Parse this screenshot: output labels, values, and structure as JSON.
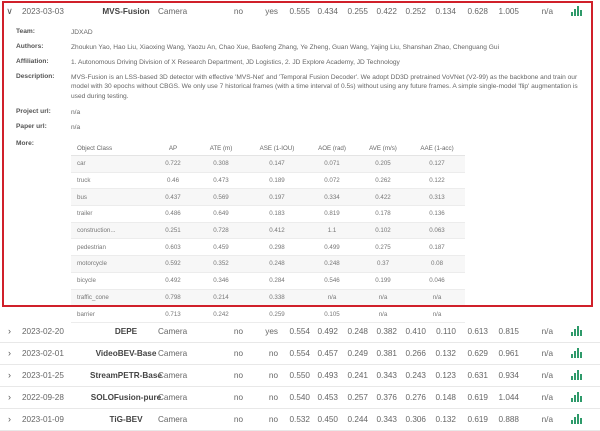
{
  "expanded_entry": {
    "date": "2023-03-03",
    "method": "MVS-Fusion",
    "modality": "Camera",
    "extra_data": "no",
    "tta": "yes",
    "metrics": [
      "0.555",
      "0.434",
      "0.255",
      "0.422",
      "0.252",
      "0.134",
      "0.628",
      "1.005"
    ],
    "last": "n/a",
    "details": {
      "team_label": "Team:",
      "team": "JDXAD",
      "authors_label": "Authors:",
      "authors": "Zhoukun Yao, Hao Liu, Xiaoxing Wang, Yaozu An, Chao Xue, Baofeng Zhang, Ye Zheng, Guan Wang, Yajing Liu, Shanshan Zhao, Chenguang Gui",
      "affiliation_label": "Affiliation:",
      "affiliation": "1. Autonomous Driving Division of X Research Department, JD Logistics, 2. JD Explore Academy, JD Technology",
      "description_label": "Description:",
      "description": "MVS-Fusion is an LSS-based 3D detector with effective 'MVS-Net' and 'Temporal Fusion Decoder'. We adopt DD3D pretrained VoVNet (V2-99) as the backbone and train our model with 30 epochs without CBGS. We only use 7 historical frames (with a time interval of 0.5s) without using any future frames. A simple single-model 'flip' augmentation is used during testing.",
      "project_url_label": "Project url:",
      "project_url": "n/a",
      "paper_url_label": "Paper url:",
      "paper_url": "n/a",
      "more_label": "More:"
    },
    "object_table": {
      "headers": [
        "Object Class",
        "AP",
        "ATE (m)",
        "ASE (1-IOU)",
        "AOE (rad)",
        "AVE (m/s)",
        "AAE (1-acc)"
      ],
      "rows": [
        [
          "car",
          "0.722",
          "0.308",
          "0.147",
          "0.071",
          "0.205",
          "0.127"
        ],
        [
          "truck",
          "0.46",
          "0.473",
          "0.189",
          "0.072",
          "0.262",
          "0.122"
        ],
        [
          "bus",
          "0.437",
          "0.569",
          "0.197",
          "0.334",
          "0.422",
          "0.313"
        ],
        [
          "trailer",
          "0.486",
          "0.649",
          "0.183",
          "0.819",
          "0.178",
          "0.136"
        ],
        [
          "construction...",
          "0.251",
          "0.728",
          "0.412",
          "1.1",
          "0.102",
          "0.063"
        ],
        [
          "pedestrian",
          "0.603",
          "0.459",
          "0.298",
          "0.499",
          "0.275",
          "0.187"
        ],
        [
          "motorcycle",
          "0.592",
          "0.352",
          "0.248",
          "0.248",
          "0.37",
          "0.08"
        ],
        [
          "bicycle",
          "0.492",
          "0.346",
          "0.284",
          "0.546",
          "0.199",
          "0.046"
        ],
        [
          "traffic_cone",
          "0.798",
          "0.214",
          "0.338",
          "n/a",
          "n/a",
          "n/a"
        ],
        [
          "barrier",
          "0.713",
          "0.242",
          "0.259",
          "0.105",
          "n/a",
          "n/a"
        ]
      ]
    }
  },
  "entries": [
    {
      "date": "2023-02-20",
      "method": "DEPE",
      "modality": "Camera",
      "extra_data": "no",
      "tta": "yes",
      "metrics": [
        "0.554",
        "0.492",
        "0.248",
        "0.382",
        "0.410",
        "0.110",
        "0.613",
        "0.815"
      ],
      "last": "n/a"
    },
    {
      "date": "2023-02-01",
      "method": "VideoBEV-Base",
      "modality": "Camera",
      "extra_data": "no",
      "tta": "no",
      "metrics": [
        "0.554",
        "0.457",
        "0.249",
        "0.381",
        "0.266",
        "0.132",
        "0.629",
        "0.961"
      ],
      "last": "n/a"
    },
    {
      "date": "2023-01-25",
      "method": "StreamPETR-Base",
      "modality": "Camera",
      "extra_data": "no",
      "tta": "no",
      "metrics": [
        "0.550",
        "0.493",
        "0.241",
        "0.343",
        "0.243",
        "0.123",
        "0.631",
        "0.934"
      ],
      "last": "n/a"
    },
    {
      "date": "2022-09-28",
      "method": "SOLOFusion-pure",
      "modality": "Camera",
      "extra_data": "no",
      "tta": "no",
      "metrics": [
        "0.540",
        "0.453",
        "0.257",
        "0.376",
        "0.276",
        "0.148",
        "0.619",
        "1.044"
      ],
      "last": "n/a"
    },
    {
      "date": "2023-01-09",
      "method": "TiG-BEV",
      "modality": "Camera",
      "extra_data": "no",
      "tta": "no",
      "metrics": [
        "0.532",
        "0.450",
        "0.244",
        "0.343",
        "0.306",
        "0.132",
        "0.619",
        "0.888"
      ],
      "last": "n/a"
    }
  ],
  "icons": {
    "expanded": "chevron-down-icon",
    "collapsed": "chevron-right-icon",
    "chart": "bar-chart-icon"
  },
  "colors": {
    "highlight_border": "#d0202a",
    "chart_icon": "#2e9a6a"
  }
}
